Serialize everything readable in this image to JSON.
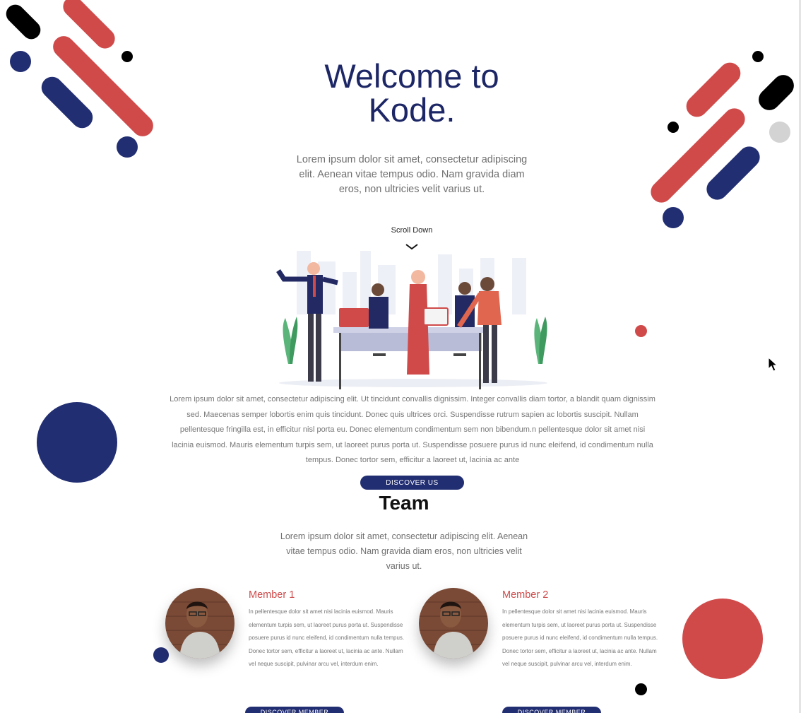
{
  "hero": {
    "title_line1": "Welcome to",
    "title_line2": "Kode.",
    "subtitle": "Lorem ipsum dolor sit amet, consectetur adipiscing elit. Aenean vitae tempus odio. Nam gravida diam eros, non ultricies velit varius ut.",
    "scroll_label": "Scroll Down"
  },
  "about": {
    "text": "Lorem ipsum dolor sit amet, consectetur adipiscing elit. Ut tincidunt convallis dignissim. Integer convallis diam tortor, a blandit quam dignissim sed. Maecenas semper lobortis enim quis tincidunt. Donec quis ultrices orci. Suspendisse rutrum sapien ac lobortis suscipit. Nullam pellentesque fringilla est, in efficitur nisl porta eu. Donec elementum condimentum sem non bibendum.n pellentesque dolor sit amet nisi lacinia euismod. Mauris elementum turpis sem, ut laoreet purus porta ut. Suspendisse posuere purus id nunc eleifend, id condimentum nulla tempus. Donec tortor sem, efficitur a laoreet ut, lacinia ac ante",
    "button_label": "DISCOVER US"
  },
  "team": {
    "title": "Team",
    "subtitle": "Lorem ipsum dolor sit amet, consectetur adipiscing elit. Aenean vitae tempus odio. Nam gravida diam eros, non ultricies velit varius ut.",
    "members": [
      {
        "name": "Member 1",
        "bio": "In pellentesque dolor sit amet nisi lacinia euismod. Mauris elementum turpis sem, ut laoreet purus porta ut. Suspendisse posuere purus id nunc eleifend, id condimentum nulla tempus. Donec tortor sem, efficitur a laoreet ut, lacinia ac ante. Nullam vel neque suscipit, pulvinar arcu vel, interdum enim.",
        "button_label": "DISCOVER MEMBER"
      },
      {
        "name": "Member 2",
        "bio": "In pellentesque dolor sit amet nisi lacinia euismod. Mauris elementum turpis sem, ut laoreet purus porta ut. Suspendisse posuere purus id nunc eleifend, id condimentum nulla tempus. Donec tortor sem, efficitur a laoreet ut, lacinia ac ante. Nullam vel neque suscipit, pulvinar arcu vel, interdum enim.",
        "button_label": "DISCOVER MEMBER"
      }
    ]
  },
  "colors": {
    "navy": "#222e72",
    "red": "#d04a4a",
    "black": "#000000",
    "grey": "#d3d3d3"
  },
  "icons": {
    "scroll": "chevron-down-icon",
    "cursor": "mouse-cursor-icon"
  }
}
